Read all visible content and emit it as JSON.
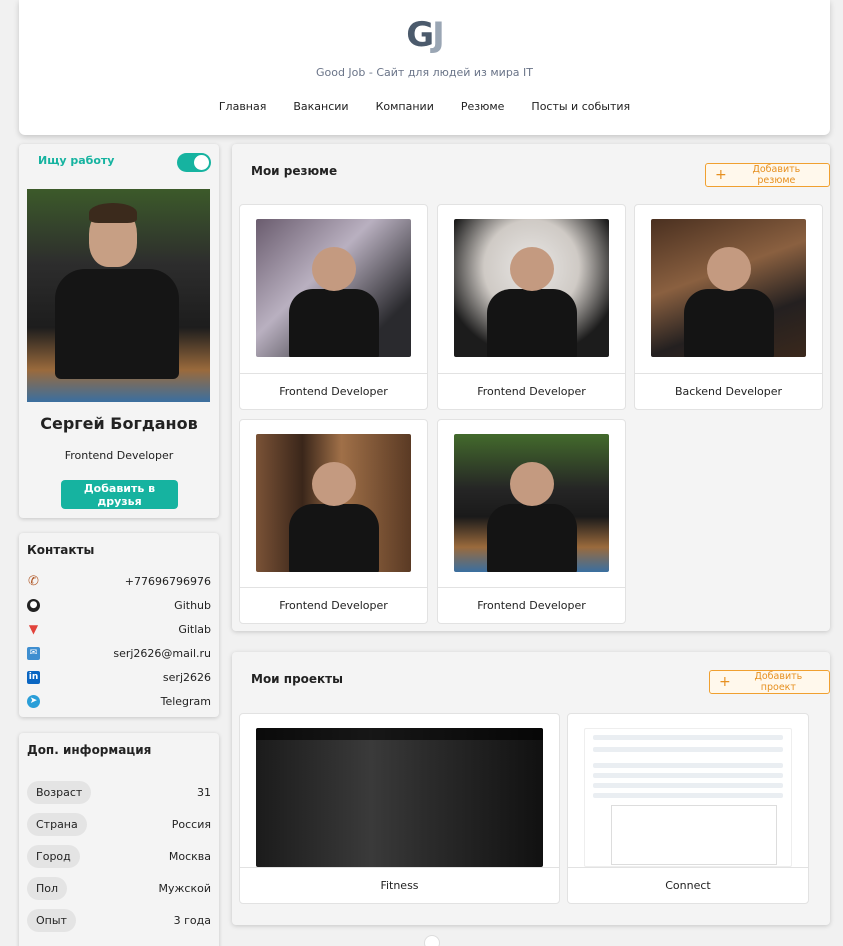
{
  "header": {
    "logo_g": "G",
    "logo_j": "J",
    "tagline": "Good Job - Сайт для людей из мира IT",
    "nav": [
      "Главная",
      "Вакансии",
      "Компании",
      "Резюме",
      "Посты и события"
    ]
  },
  "profile": {
    "job_search_label": "Ищу работу",
    "job_search_on": true,
    "name": "Сергей Богданов",
    "position": "Frontend Developer",
    "add_friend_label": "Добавить в друзья"
  },
  "contacts": {
    "title": "Контакты",
    "items": [
      {
        "icon": "phone-icon",
        "value": "+77696796976"
      },
      {
        "icon": "github-icon",
        "value": "Github"
      },
      {
        "icon": "gitlab-icon",
        "value": "Gitlab"
      },
      {
        "icon": "mail-icon",
        "value": "serj2626@mail.ru"
      },
      {
        "icon": "linkedin-icon",
        "value": "serj2626"
      },
      {
        "icon": "telegram-icon",
        "value": "Telegram"
      }
    ]
  },
  "info": {
    "title": "Доп. информация",
    "rows": [
      {
        "label": "Возраст",
        "value": "31"
      },
      {
        "label": "Страна",
        "value": "Россия"
      },
      {
        "label": "Город",
        "value": "Москва"
      },
      {
        "label": "Пол",
        "value": "Мужской"
      },
      {
        "label": "Опыт",
        "value": "3 года"
      }
    ]
  },
  "resumes": {
    "title": "Мои резюме",
    "add_label": "Добавить резюме",
    "items": [
      {
        "title": "Frontend Developer"
      },
      {
        "title": "Frontend Developer"
      },
      {
        "title": "Backend Developer"
      },
      {
        "title": "Frontend Developer"
      },
      {
        "title": "Frontend Developer"
      }
    ]
  },
  "projects": {
    "title": "Мои проекты",
    "add_label": "Добавить проект",
    "items": [
      {
        "title": "Fitness"
      },
      {
        "title": "Connect"
      }
    ]
  },
  "colors": {
    "accent": "#16b3a0",
    "add_button": "#e69020"
  }
}
